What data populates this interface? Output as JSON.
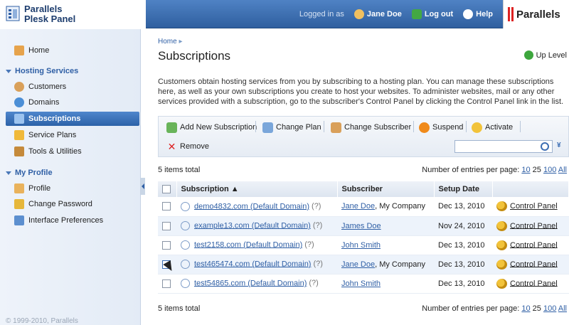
{
  "header": {
    "brand_line1": "Parallels",
    "brand_line2": "Plesk Panel",
    "logged_in_label": "Logged in as",
    "user_name": "Jane Doe",
    "logout_label": "Log out",
    "help_label": "Help",
    "vendor_logo_text": "Parallels"
  },
  "sidebar": {
    "home": "Home",
    "section_hosting": "Hosting Services",
    "customers": "Customers",
    "domains": "Domains",
    "subscriptions": "Subscriptions",
    "service_plans": "Service Plans",
    "tools": "Tools & Utilities",
    "section_profile": "My Profile",
    "profile": "Profile",
    "change_password": "Change Password",
    "interface_prefs": "Interface Preferences",
    "copyright": "© 1999-2010, Parallels"
  },
  "main": {
    "breadcrumb": "Home",
    "title": "Subscriptions",
    "up_level": "Up Level",
    "description": "Customers obtain hosting services from you by subscribing to a hosting plan. You can manage these subscriptions here, as well as your own subscriptions you create to host your websites. To administer websites, mail or any other services provided with a subscription, go to the subscriber's Control Panel by clicking the Control Panel link in the list.",
    "toolbar": {
      "add": "Add New Subscription",
      "change_plan": "Change Plan",
      "change_subscriber": "Change Subscriber",
      "suspend": "Suspend",
      "activate": "Activate",
      "remove": "Remove"
    },
    "items_total": "5 items total",
    "per_page_label": "Number of entries per page:",
    "per_page_10": "10",
    "per_page_25": "25",
    "per_page_100": "100",
    "per_page_all": "All",
    "columns": [
      "Subscription ▲",
      "Subscriber",
      "Setup Date",
      ""
    ],
    "rows": [
      {
        "domain": "demo4832.com (Default Domain)",
        "q": "(?)",
        "subscriber": "Jane Doe",
        "company": ", My Company",
        "date": "Dec 13, 2010",
        "cp": "Control Panel"
      },
      {
        "domain": "example13.com (Default Domain)",
        "q": "(?)",
        "subscriber": "James Doe",
        "company": "",
        "date": "Nov 24, 2010",
        "cp": "Control Panel"
      },
      {
        "domain": "test2158.com (Default Domain)",
        "q": "(?)",
        "subscriber": "John Smith",
        "company": "",
        "date": "Dec 13, 2010",
        "cp": "Control Panel"
      },
      {
        "domain": "test465474.com (Default Domain)",
        "q": "(?)",
        "subscriber": "Jane Doe",
        "company": ", My Company",
        "date": "Dec 13, 2010",
        "cp": "Control Panel"
      },
      {
        "domain": "test54865.com (Default Domain)",
        "q": "(?)",
        "subscriber": "John Smith",
        "company": "",
        "date": "Dec 13, 2010",
        "cp": "Control Panel"
      }
    ]
  }
}
